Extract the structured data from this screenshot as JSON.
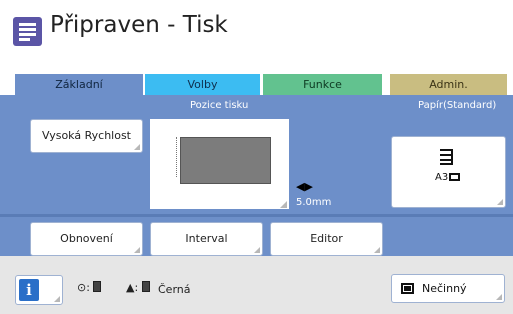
{
  "header": {
    "title": "Připraven - Tisk",
    "icon": "document-list-icon"
  },
  "tabs": [
    {
      "label": "Základní",
      "color": "#6d8fc9",
      "active": true
    },
    {
      "label": "Volby",
      "color": "#3cbcf2",
      "active": false
    },
    {
      "label": "Funkce",
      "color": "#62c28f",
      "active": false
    },
    {
      "label": "Admin.",
      "color": "#c9bd81",
      "active": false
    }
  ],
  "main": {
    "speed_button": "Vysoká Rychlost",
    "position_label": "Pozice tisku",
    "offset_value": "5.0mm",
    "paper_label": "Papír(Standard)",
    "paper_size": "A3",
    "buttons": {
      "refresh": "Obnovení",
      "interval": "Interval",
      "editor": "Editor"
    }
  },
  "status": {
    "info_icon": "info-icon",
    "master_separator": ":",
    "ink_separator": ":",
    "ink_color": "Černá",
    "idle_label": "Nečinný"
  },
  "colors": {
    "panel": "#6d8fc9",
    "title_icon": "#5b55a6",
    "status_bar": "#e6e6e6"
  }
}
